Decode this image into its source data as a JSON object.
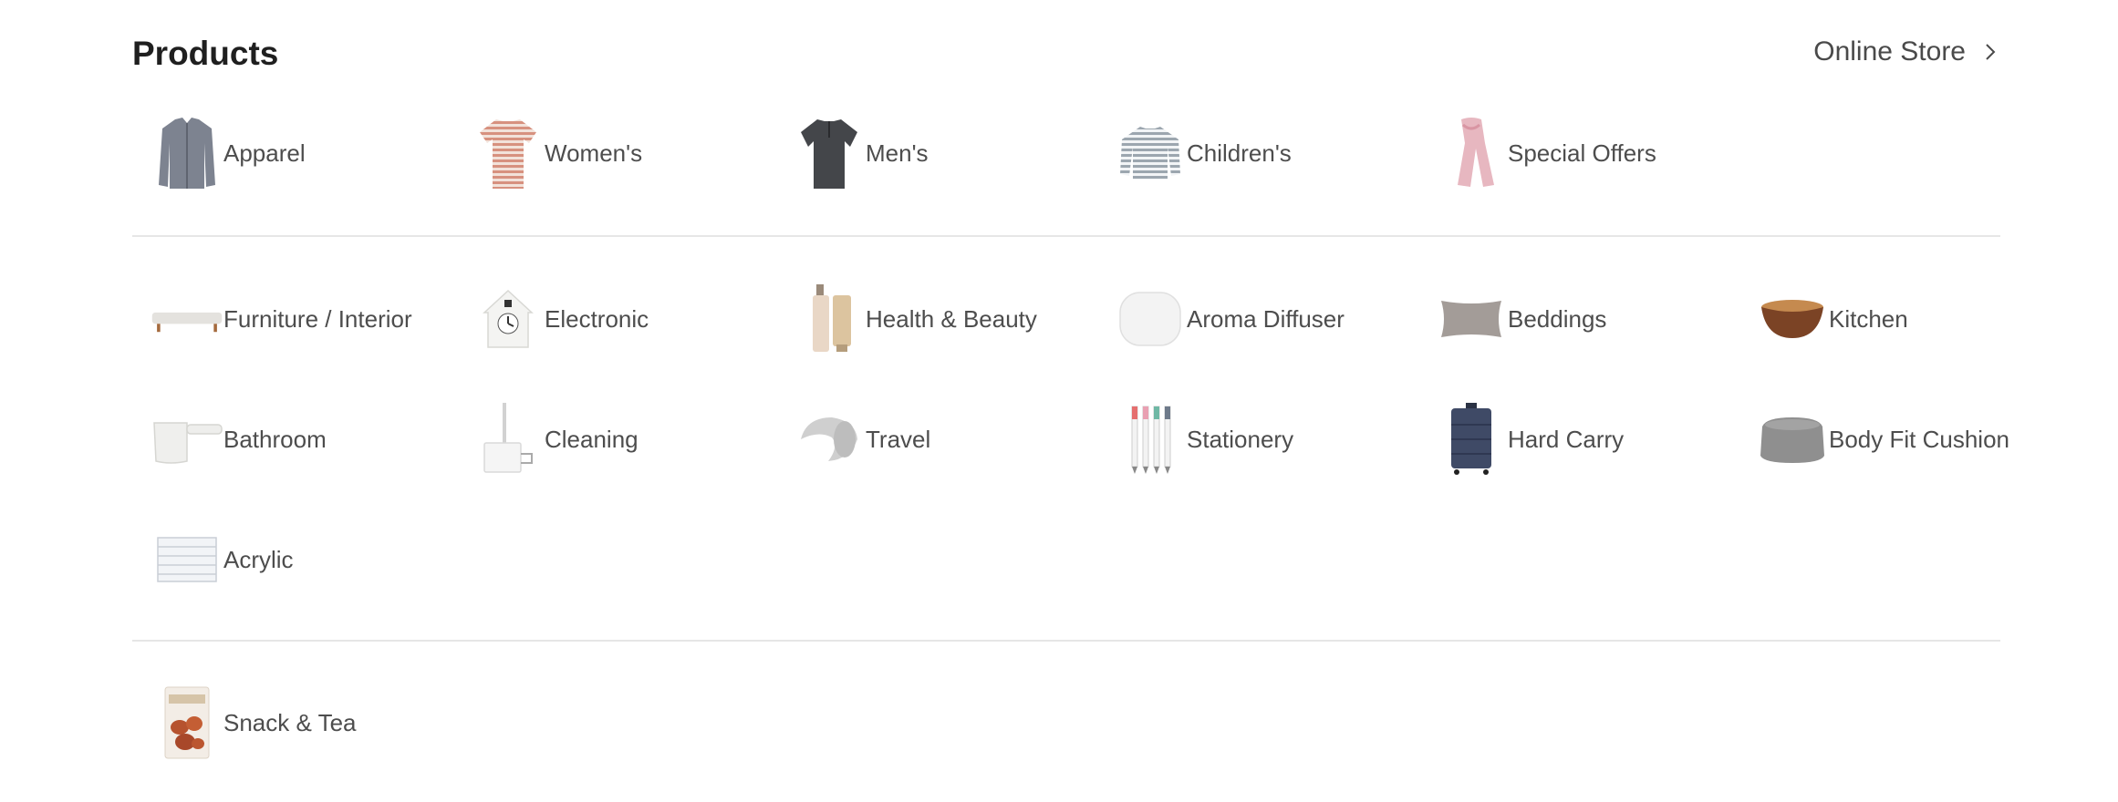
{
  "header": {
    "title": "Products",
    "store_link": "Online Store"
  },
  "apparel": [
    {
      "label": "Apparel",
      "icon": "cardigan-icon"
    },
    {
      "label": "Women's",
      "icon": "striped-tshirt-icon"
    },
    {
      "label": "Men's",
      "icon": "henley-shirt-icon"
    },
    {
      "label": "Children's",
      "icon": "striped-longsleeve-icon"
    },
    {
      "label": "Special Offers",
      "icon": "scarf-icon"
    }
  ],
  "goods": [
    {
      "label": "Furniture / Interior",
      "icon": "bench-icon"
    },
    {
      "label": "Electronic",
      "icon": "cuckoo-clock-icon"
    },
    {
      "label": "Health & Beauty",
      "icon": "bottle-and-tube-icon"
    },
    {
      "label": "Aroma Diffuser",
      "icon": "diffuser-icon"
    },
    {
      "label": "Beddings",
      "icon": "pillow-icon"
    },
    {
      "label": "Kitchen",
      "icon": "wooden-bowl-icon"
    },
    {
      "label": "Bathroom",
      "icon": "ladle-icon"
    },
    {
      "label": "Cleaning",
      "icon": "lint-roller-icon"
    },
    {
      "label": "Travel",
      "icon": "neck-pillow-icon"
    },
    {
      "label": "Stationery",
      "icon": "pens-icon"
    },
    {
      "label": "Hard Carry",
      "icon": "suitcase-icon"
    },
    {
      "label": "Body Fit Cushion",
      "icon": "bean-bag-icon"
    },
    {
      "label": "Acrylic",
      "icon": "acrylic-drawers-icon"
    }
  ],
  "food": [
    {
      "label": "Snack & Tea",
      "icon": "snack-bag-icon"
    }
  ]
}
